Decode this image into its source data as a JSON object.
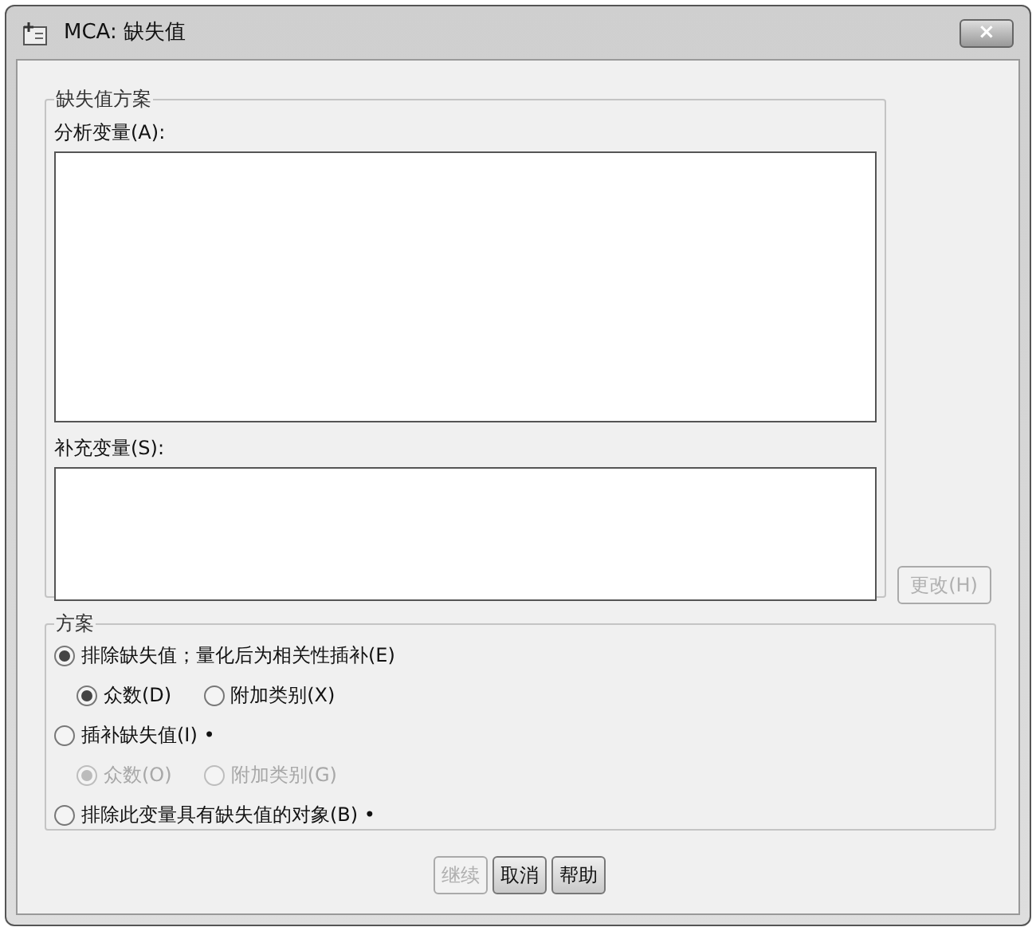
{
  "window": {
    "title": "MCA: 缺失值",
    "close": "×"
  },
  "missing_group": {
    "title": "缺失值方案",
    "lists": [
      {
        "label": "分析变量(A):"
      },
      {
        "label": "补充变量(S):"
      }
    ],
    "change_button": {
      "label": "更改(H)",
      "disabled": true
    }
  },
  "scheme_group": {
    "title": "方案",
    "options": [
      {
        "label": "排除缺失值；量化后为相关性插补(E)",
        "selected": true,
        "disabled": false,
        "children": [
          {
            "label": "众数(D)",
            "selected": true,
            "disabled": false
          },
          {
            "label": "附加类别(X)",
            "selected": false,
            "disabled": false
          }
        ]
      },
      {
        "label": "插补缺失值(I) •",
        "selected": false,
        "disabled": false,
        "children": [
          {
            "label": "众数(O)",
            "selected": true,
            "disabled": true
          },
          {
            "label": "附加类别(G)",
            "selected": false,
            "disabled": true
          }
        ]
      },
      {
        "label": "排除此变量具有缺失值的对象(B) •",
        "selected": false,
        "disabled": false
      }
    ]
  },
  "buttons": [
    {
      "label": "继续",
      "disabled": true
    },
    {
      "label": "取消",
      "disabled": false
    },
    {
      "label": "帮助",
      "disabled": false
    }
  ]
}
